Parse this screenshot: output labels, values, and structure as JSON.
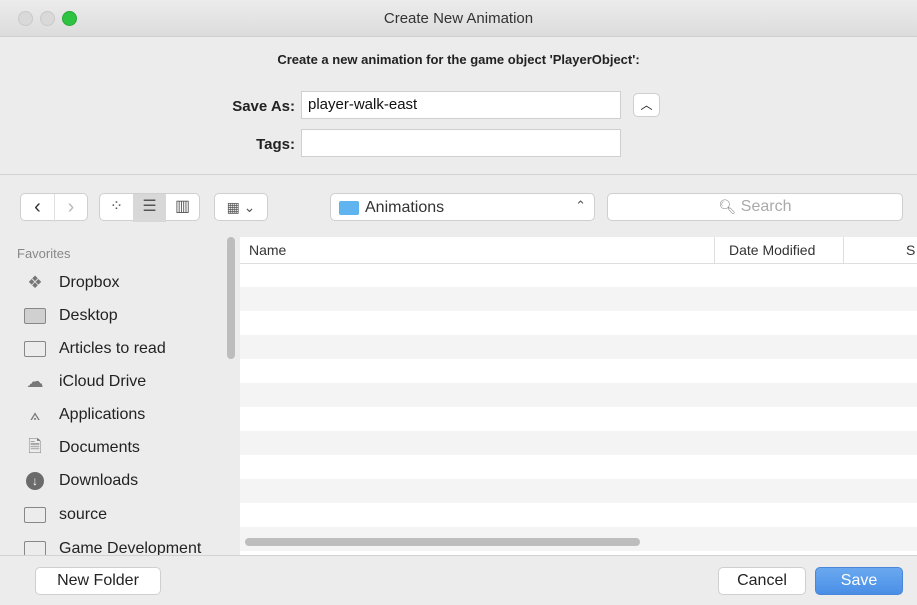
{
  "window": {
    "title": "Create New Animation"
  },
  "prompt": "Create a new animation for the game object 'PlayerObject':",
  "form": {
    "save_as_label": "Save As:",
    "save_as_value": "player-walk-east",
    "tags_label": "Tags:",
    "tags_value": ""
  },
  "toolbar": {
    "back": "‹",
    "forward": "›",
    "location": "Animations",
    "search_placeholder": "Search",
    "selected_view": "list"
  },
  "sidebar": {
    "heading": "Favorites",
    "items": [
      {
        "label": "Dropbox",
        "icon": "dropbox-icon"
      },
      {
        "label": "Desktop",
        "icon": "desktop-icon"
      },
      {
        "label": "Articles to read",
        "icon": "folder-icon"
      },
      {
        "label": "iCloud Drive",
        "icon": "cloud-icon"
      },
      {
        "label": "Applications",
        "icon": "applications-icon"
      },
      {
        "label": "Documents",
        "icon": "documents-icon"
      },
      {
        "label": "Downloads",
        "icon": "downloads-icon"
      },
      {
        "label": "source",
        "icon": "folder-icon"
      },
      {
        "label": "Game Development",
        "icon": "folder-icon"
      }
    ]
  },
  "file_list": {
    "columns": [
      "Name",
      "Date Modified",
      "S"
    ],
    "rows": []
  },
  "buttons": {
    "new_folder": "New Folder",
    "cancel": "Cancel",
    "save": "Save"
  },
  "colors": {
    "accent": "#4a8fe6",
    "folder": "#5fb3ee",
    "zoom": "#2ec441"
  }
}
